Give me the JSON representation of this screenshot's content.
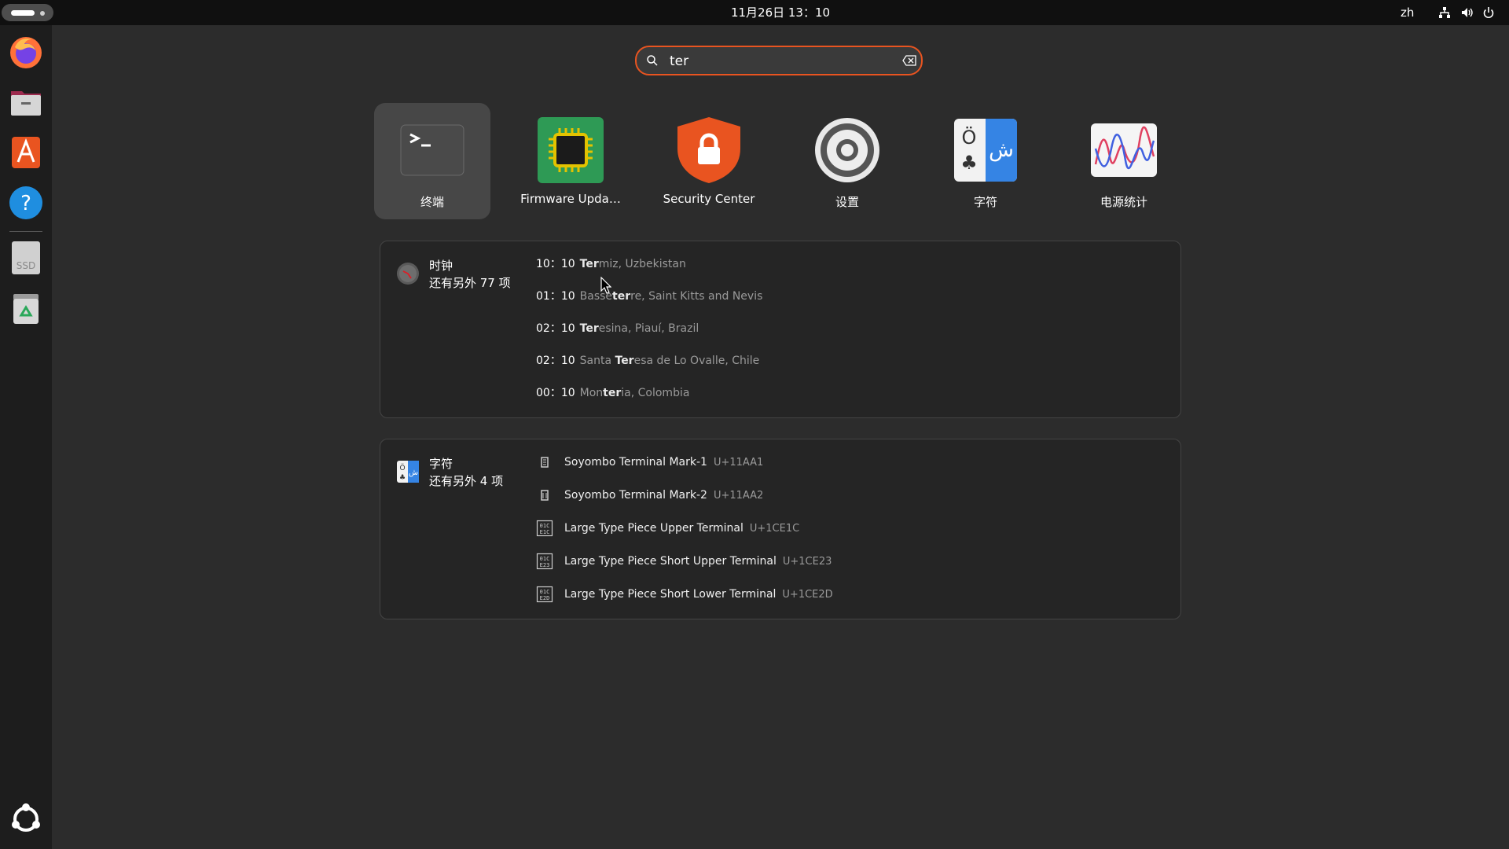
{
  "topbar": {
    "datetime": "11月26日 13：10",
    "language": "zh",
    "icons": [
      "network-icon",
      "volume-icon",
      "power-icon"
    ]
  },
  "dock": {
    "items": [
      {
        "name": "firefox-icon"
      },
      {
        "name": "files-icon"
      },
      {
        "name": "app-center-icon"
      },
      {
        "name": "help-icon"
      },
      {
        "name": "ssd-drive-icon",
        "label": "SSD"
      },
      {
        "name": "trash-icon"
      },
      {
        "name": "show-apps-icon"
      }
    ]
  },
  "search": {
    "value": "ter"
  },
  "apps": [
    {
      "label": "终端"
    },
    {
      "label": "Firmware Upda…"
    },
    {
      "label": "Security Center"
    },
    {
      "label": "设置"
    },
    {
      "label": "字符"
    },
    {
      "label": "电源统计"
    }
  ],
  "clock_results": {
    "provider": "时钟",
    "more": "还有另外 77 项",
    "items": [
      {
        "time": "10：10",
        "pre": "",
        "match": "Ter",
        "post": "miz, Uzbekistan"
      },
      {
        "time": "01：10",
        "pre": "Basse",
        "match": "ter",
        "post": "re, Saint Kitts and Nevis"
      },
      {
        "time": "02：10",
        "pre": "",
        "match": "Ter",
        "post": "esina, Piauí, Brazil"
      },
      {
        "time": "02：10",
        "pre": "Santa ",
        "match": "Ter",
        "post": "esa de Lo Ovalle, Chile"
      },
      {
        "time": "00：10",
        "pre": "Mon",
        "match": "ter",
        "post": "ia, Colombia"
      }
    ]
  },
  "char_results": {
    "provider": "字符",
    "more": "还有另外 4 项",
    "items": [
      {
        "name": "Soyombo Terminal Mark-1",
        "code": "U+11AA1"
      },
      {
        "name": "Soyombo Terminal Mark-2",
        "code": "U+11AA2"
      },
      {
        "name": "Large Type Piece Upper Terminal",
        "code": "U+1CE1C"
      },
      {
        "name": "Large Type Piece Short Upper Terminal",
        "code": "U+1CE23"
      },
      {
        "name": "Large Type Piece Short Lower Terminal",
        "code": "U+1CE2D"
      }
    ]
  },
  "colors": {
    "accent": "#e95420",
    "background": "#2c2c2c",
    "dock": "#1d1d1d",
    "topbar": "#101010"
  }
}
